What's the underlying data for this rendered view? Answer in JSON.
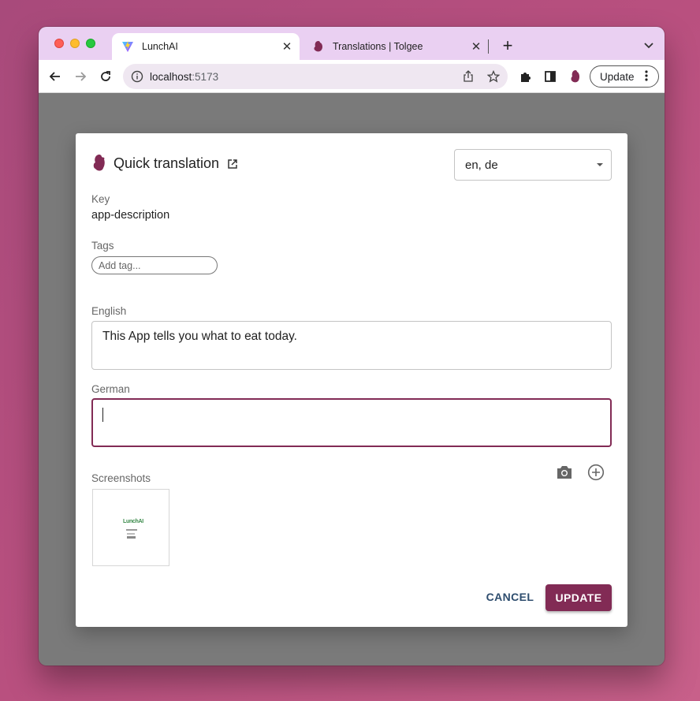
{
  "browser": {
    "tabs": [
      {
        "title": "LunchAI",
        "favicon": "vite-icon",
        "active": true
      },
      {
        "title": "Translations | Tolgee",
        "favicon": "tolgee-icon",
        "active": false
      }
    ],
    "url_host": "localhost",
    "url_port": ":5173",
    "update_label": "Update"
  },
  "dialog": {
    "title": "Quick translation",
    "languages_value": "en, de",
    "key_label": "Key",
    "key_value": "app-description",
    "tags_label": "Tags",
    "tag_placeholder": "Add tag...",
    "fields": [
      {
        "label": "English",
        "value": "This App tells you what to eat today."
      },
      {
        "label": "German",
        "value": ""
      }
    ],
    "screenshots_label": "Screenshots",
    "thumbnail_logo_text": "LunchAI",
    "cancel_label": "CANCEL",
    "update_label": "UPDATE"
  },
  "colors": {
    "brand": "#822b55",
    "cancel_text": "#2e4d6e",
    "tabbar": "#ead0f2"
  }
}
